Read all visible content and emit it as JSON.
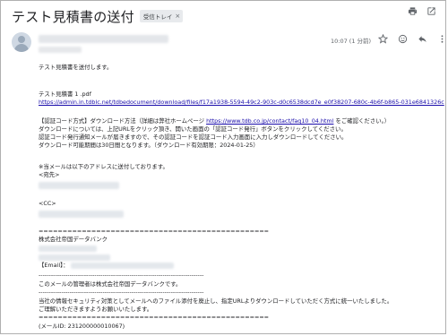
{
  "header": {
    "subject": "テスト見積書の送付",
    "label_badge": "受信トレイ",
    "label_badge_close": "×"
  },
  "message": {
    "time": "10:07 (1 分前)"
  },
  "body": {
    "greeting": "テスト見積書を送付します。",
    "attachment_name": "テスト見積書 1 .pdf",
    "download_link": "https://admin.in.tdblc.net/tdbedocument/download/files/f17a1938-5594-49c2-903c-d0c6538dcd7e_e0f38207-680c-4b6f-b865-031e6841326c",
    "auth_line1_pre": "【認証コード方式】ダウンロード方法（詳細は弊社ホームページ",
    "auth_line1_link": "https://www.tdb.co.jp/contact/faq10_04.html",
    "auth_line1_post": "をご確認ください。）",
    "auth_line2": "ダウンロードについては、上記URLをクリック頂き、開いた画面の「認証コード発行」ボタンをクリックしてください。",
    "auth_line3": "認証コード発行通知メールが届きますので、その認証コードを認証コード入力画面に入力しダウンロードしてください。",
    "auth_line4": "ダウンロード可能期間は30日間となります。（ダウンロード有効期限：2024-01-25）",
    "notice": "※当メールは以下のアドレスに送付しております。",
    "to_label": "<宛先>",
    "cc_label": "<CC>",
    "separator": "================================================",
    "company": "株式会社帝国データバンク",
    "email_label": "【Email】：",
    "dash_separator": "--------------------------------------------------------------------------------",
    "admin_notice": "このメールの管理者は株式会社帝国データバンクです。",
    "security_line1": "当社の情報セキュリティ対策としてメールへのファイル添付を廃止し、指定URLよりダウンロードしていただく方式に統一いたしました。",
    "security_line2": "ご理解いただきますようお願いいたします。",
    "mail_id": "(メールID: 231200000010067)"
  },
  "icons": {
    "print": "print-icon",
    "open_new": "open-in-new-icon",
    "star": "star-icon",
    "emoji": "emoji-icon",
    "reply": "reply-icon",
    "more": "more-vert-icon"
  }
}
